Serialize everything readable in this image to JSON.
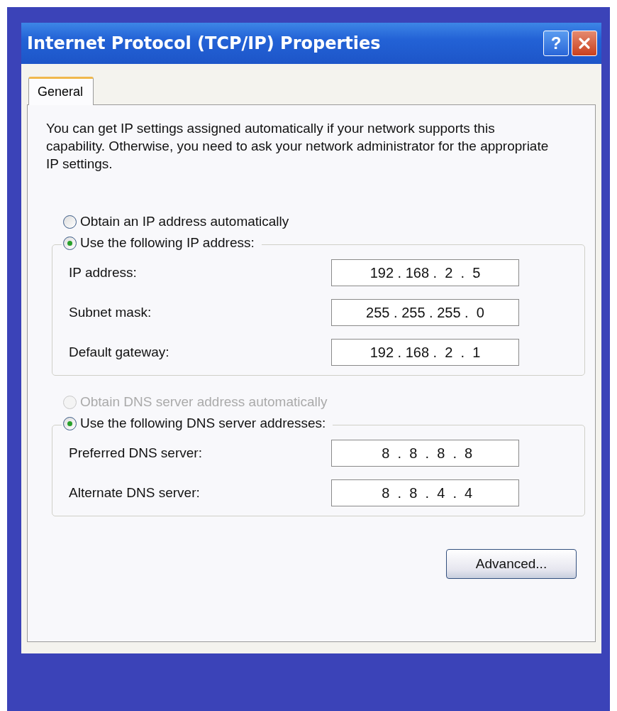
{
  "window": {
    "title": "Internet Protocol (TCP/IP) Properties",
    "help_button": "?"
  },
  "tabs": [
    {
      "label": "General",
      "selected": true
    }
  ],
  "intro": "You can get IP settings assigned automatically if your network supports this capability. Otherwise, you need to ask your network administrator for the appropriate IP settings.",
  "ip_options": [
    {
      "label": "Obtain an IP address automatically",
      "selected": false,
      "disabled": false
    },
    {
      "label": "Use the following IP address:",
      "selected": true,
      "disabled": false
    }
  ],
  "ip_fields": [
    {
      "label": "IP address:",
      "value": "192 . 168 .  2  .  5"
    },
    {
      "label": "Subnet mask:",
      "value": "255 . 255 . 255 .  0"
    },
    {
      "label": "Default gateway:",
      "value": "192 . 168 .  2  .  1"
    }
  ],
  "dns_options": [
    {
      "label": "Obtain DNS server address automatically",
      "selected": false,
      "disabled": true
    },
    {
      "label": "Use the following DNS server addresses:",
      "selected": true,
      "disabled": false
    }
  ],
  "dns_fields": [
    {
      "label": "Preferred DNS server:",
      "value": " 8  .  8  .  8  .  8"
    },
    {
      "label": "Alternate DNS server:",
      "value": " 8  .  8  .  4  .  4"
    }
  ],
  "buttons": [
    {
      "label": "Advanced..."
    }
  ]
}
